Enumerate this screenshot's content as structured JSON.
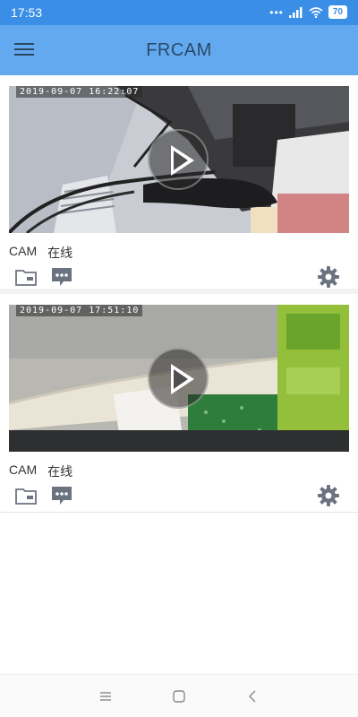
{
  "status_bar": {
    "time": "17:53",
    "signal_dots": "•••",
    "battery": "70"
  },
  "app_bar": {
    "title": "FRCAM",
    "menu_icon": "hamburger-menu-icon"
  },
  "devices": [
    {
      "timestamp": "2019-09-07 16:22:07",
      "name": "CAM",
      "status": "在线"
    },
    {
      "timestamp": "2019-09-07 17:51:10",
      "name": "CAM",
      "status": "在线"
    }
  ],
  "colors": {
    "status_bar": "#3a8ee6",
    "app_bar": "#63a9ef",
    "title": "#2a4a66",
    "icon": "#6b7280"
  }
}
